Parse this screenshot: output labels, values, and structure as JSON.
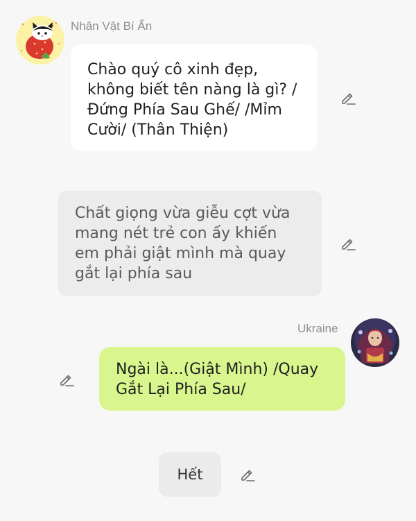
{
  "messages": [
    {
      "type": "character",
      "sender": "Nhân Vật Bí Ẩn",
      "text": "Chào quý cô xinh đẹp, không biết tên nàng là gì? /Đứng Phía Sau Ghế/ /Mỉm Cười/ (Thân Thiện)"
    },
    {
      "type": "narration",
      "text": "Chất giọng vừa giễu cợt vừa mang nét trẻ con ấy khiến em phải giật mình mà quay gắt lại phía sau"
    },
    {
      "type": "user",
      "sender": "Ukraine",
      "text": "Ngài là...(Giật Mình) /Quay Gắt Lại Phía Sau/"
    }
  ],
  "end_button": {
    "label": "Hết"
  },
  "icons": {
    "edit": "pencil-edit-icon",
    "character_avatar": "cat-with-strawberry-avatar",
    "user_avatar": "illustrated-girl-avatar"
  },
  "colors": {
    "background": "#f7f7f7",
    "character_bubble": "#ffffff",
    "narration_bubble": "#ececec",
    "user_bubble": "#d9f58d",
    "name_text": "#8e8e8e"
  }
}
